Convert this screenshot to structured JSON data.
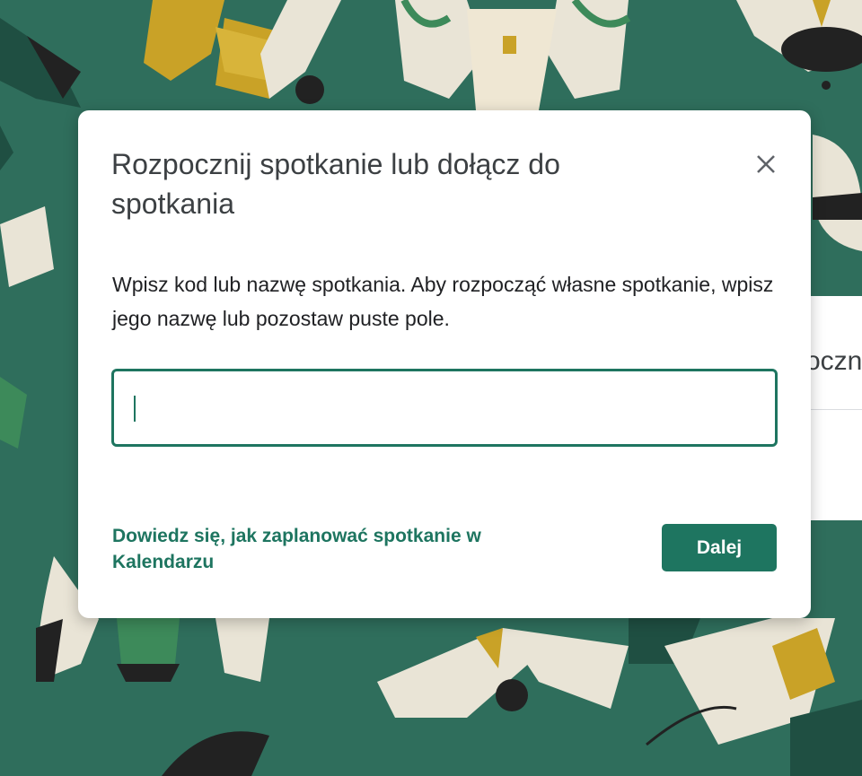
{
  "dialog": {
    "title": "Rozpocznij spotkanie lub dołącz do spotkania",
    "description": "Wpisz kod lub nazwę spotkania. Aby rozpocząć własne spotkanie, wpisz jego nazwę lub pozostaw puste pole.",
    "input_value": "",
    "learn_link": "Dowiedz się, jak zaplanować spotkanie w Kalendarzu",
    "next_button": "Dalej",
    "close_icon": "close-icon"
  },
  "background": {
    "partial_card_text": "ocznij"
  },
  "colors": {
    "background": "#2f6e5c",
    "accent": "#1e7560",
    "dialog": "#ffffff",
    "title_text": "#3c4043",
    "body_text": "#202124"
  }
}
